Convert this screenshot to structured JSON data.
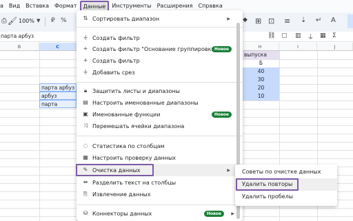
{
  "menubar": {
    "items": [
      {
        "label": "а"
      },
      {
        "label": "Вид"
      },
      {
        "label": "Вставка"
      },
      {
        "label": "Формат"
      },
      {
        "label": "Данные",
        "active": true
      },
      {
        "label": "Инструменты"
      },
      {
        "label": "Расширения"
      },
      {
        "label": "Справка"
      }
    ]
  },
  "toolbar": {
    "paint_format_icon": "paint-format-icon",
    "zoom": "100%",
    "zoom_dropdown_icon": "chevron-down-icon"
  },
  "formula_bar": {
    "value": "парта арбуз"
  },
  "columns": [
    {
      "label": "B"
    },
    {
      "label": "C",
      "selected": true
    },
    {
      "label": "H"
    },
    {
      "label": "I"
    },
    {
      "label": "J"
    }
  ],
  "cells_left": [
    {
      "text": "парта арбуз"
    },
    {
      "text": "арбуз"
    },
    {
      "text": "парта"
    }
  ],
  "cells_right": [
    {
      "text": "выпуска"
    },
    {
      "text": "Б"
    },
    {
      "text": "40"
    },
    {
      "text": "30"
    },
    {
      "text": "20"
    },
    {
      "text": "10"
    }
  ],
  "data_menu": {
    "items": [
      {
        "icon": "sort-range-icon",
        "label": "Сортировать диапазон",
        "has_submenu": true
      },
      {
        "icon": "filter-icon",
        "label": "Создать фильтр"
      },
      {
        "icon": "plus-icon",
        "label": "Создать фильтр \"Основание группировки\"",
        "badge": "Новое"
      },
      {
        "icon": "plus-icon",
        "label": "Создать фильтр"
      },
      {
        "icon": "slicer-icon",
        "label": "Добавить срез"
      },
      {
        "icon": "lock-icon",
        "label": "Защитить листы и диапазоны"
      },
      {
        "icon": "named-ranges-icon",
        "label": "Настроить именованные диапазоны"
      },
      {
        "icon": "functions-icon",
        "label": "Именованные функции",
        "badge": "Новое"
      },
      {
        "icon": "shuffle-icon",
        "label": "Перемешать ячейки диапазона"
      },
      {
        "icon": "column-stats-icon",
        "label": "Статистика по столбцам"
      },
      {
        "icon": "data-validation-icon",
        "label": "Настроить проверку данных"
      },
      {
        "icon": "magic-wand-icon",
        "label": "Очистка данных",
        "has_submenu": true,
        "active": true
      },
      {
        "icon": "split-columns-icon",
        "label": "Разделить текст на столбцы"
      },
      {
        "icon": "extract-data-icon",
        "label": "Извлечение данных"
      },
      {
        "icon": "connectors-icon",
        "label": "Коннекторы данных",
        "badge": "Новое",
        "has_submenu": true
      }
    ]
  },
  "cleanup_submenu": {
    "items": [
      {
        "label": "Советы по очистке данных"
      },
      {
        "label": "Удалить повторы",
        "active": true
      },
      {
        "label": "Удалить пробелы"
      }
    ]
  },
  "colors": {
    "accent_outline": "#7b5aa6",
    "badge_green": "#188038",
    "selection_blue": "#d3e3fd",
    "cell_blue": "#c6dafc"
  }
}
